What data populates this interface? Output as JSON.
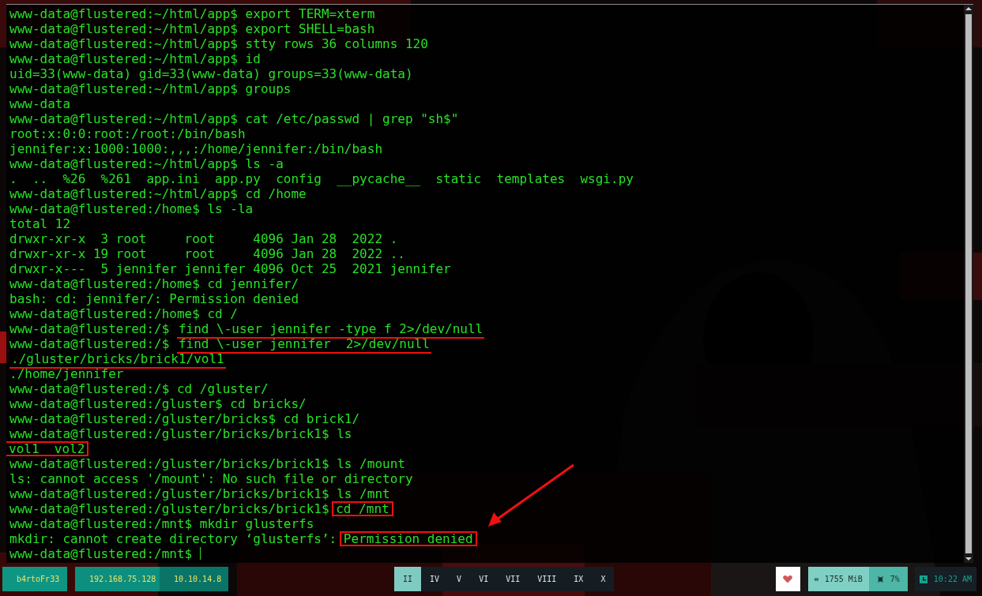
{
  "terminal": {
    "lines": [
      {
        "segments": [
          {
            "text": "www-data@flustered:~/html/app$ export TERM=xterm"
          }
        ]
      },
      {
        "segments": [
          {
            "text": "www-data@flustered:~/html/app$ export SHELL=bash"
          }
        ]
      },
      {
        "segments": [
          {
            "text": "www-data@flustered:~/html/app$ stty rows 36 columns 120"
          }
        ]
      },
      {
        "segments": [
          {
            "text": "www-data@flustered:~/html/app$ id"
          }
        ]
      },
      {
        "segments": [
          {
            "text": "uid=33(www-data) gid=33(www-data) groups=33(www-data)"
          }
        ]
      },
      {
        "segments": [
          {
            "text": "www-data@flustered:~/html/app$ groups"
          }
        ]
      },
      {
        "segments": [
          {
            "text": "www-data"
          }
        ]
      },
      {
        "segments": [
          {
            "text": "www-data@flustered:~/html/app$ cat /etc/passwd | grep \"sh$\""
          }
        ]
      },
      {
        "segments": [
          {
            "text": "root:x:0:0:root:/root:/bin/bash"
          }
        ]
      },
      {
        "segments": [
          {
            "text": "jennifer:x:1000:1000:,,,:/home/jennifer:/bin/bash"
          }
        ]
      },
      {
        "segments": [
          {
            "text": "www-data@flustered:~/html/app$ ls -a"
          }
        ]
      },
      {
        "segments": [
          {
            "text": ".  ..  %26  %261  app.ini  app.py  config  __pycache__  static  templates  wsgi.py"
          }
        ]
      },
      {
        "segments": [
          {
            "text": "www-data@flustered:~/html/app$ cd /home"
          }
        ]
      },
      {
        "segments": [
          {
            "text": "www-data@flustered:/home$ ls -la"
          }
        ]
      },
      {
        "segments": [
          {
            "text": "total 12"
          }
        ]
      },
      {
        "segments": [
          {
            "text": "drwxr-xr-x  3 root     root     4096 Jan 28  2022 ."
          }
        ]
      },
      {
        "segments": [
          {
            "text": "drwxr-xr-x 19 root     root     4096 Jan 28  2022 .."
          }
        ]
      },
      {
        "segments": [
          {
            "text": "drwxr-x---  5 jennifer jennifer 4096 Oct 25  2021 jennifer"
          }
        ]
      },
      {
        "segments": [
          {
            "text": "www-data@flustered:/home$ cd jennifer/"
          }
        ]
      },
      {
        "segments": [
          {
            "text": "bash: cd: jennifer/: Permission denied"
          }
        ]
      },
      {
        "segments": [
          {
            "text": "www-data@flustered:/home$ cd /"
          }
        ]
      },
      {
        "segments": [
          {
            "text": "www-data@flustered:/$ "
          },
          {
            "text": "find \\-user jennifer -type f 2>/dev/null",
            "underlined": true
          }
        ]
      },
      {
        "segments": [
          {
            "text": "www-data@flustered:/$ "
          },
          {
            "text": "find \\-user jennifer  2>/dev/null",
            "underlined": true
          }
        ]
      },
      {
        "segments": [
          {
            "text": "./gluster/bricks/brick1/vol1",
            "underlined": true
          }
        ]
      },
      {
        "segments": [
          {
            "text": "./home/jennifer"
          }
        ]
      },
      {
        "segments": [
          {
            "text": "www-data@flustered:/$ cd /gluster/"
          }
        ]
      },
      {
        "segments": [
          {
            "text": "www-data@flustered:/gluster$ cd bricks/"
          }
        ]
      },
      {
        "segments": [
          {
            "text": "www-data@flustered:/gluster/bricks$ cd brick1/"
          }
        ]
      },
      {
        "segments": [
          {
            "text": "www-data@flustered:/gluster/bricks/brick1$ ls"
          }
        ]
      },
      {
        "segments": [
          {
            "text": "vol1  vol2",
            "boxed": true
          }
        ]
      },
      {
        "segments": [
          {
            "text": "www-data@flustered:/gluster/bricks/brick1$ ls /mount"
          }
        ]
      },
      {
        "segments": [
          {
            "text": "ls: cannot access '/mount': No such file or directory"
          }
        ]
      },
      {
        "segments": [
          {
            "text": "www-data@flustered:/gluster/bricks/brick1$ ls /mnt"
          }
        ]
      },
      {
        "segments": [
          {
            "text": "www-data@flustered:/gluster/bricks/brick1$ "
          },
          {
            "text": "cd /mnt",
            "boxed": true
          }
        ]
      },
      {
        "segments": [
          {
            "text": "www-data@flustered:/mnt$ mkdir glusterfs"
          }
        ]
      },
      {
        "segments": [
          {
            "text": "mkdir: cannot create directory ‘glusterfs’: "
          },
          {
            "text": "Permission denied",
            "boxed": true
          }
        ]
      },
      {
        "segments": [
          {
            "text": "www-data@flustered:/mnt$ "
          }
        ],
        "cursor": true
      }
    ]
  },
  "taskbar": {
    "user": "b4rtoFr33",
    "addresses": [
      {
        "text": "192.168.75.128",
        "kind": "ethernet"
      },
      {
        "text": "10.10.14.8",
        "kind": "vpn"
      }
    ],
    "workspaces": [
      {
        "label": "II",
        "selected": true
      },
      {
        "label": "IV",
        "selected": false
      },
      {
        "label": "V",
        "selected": false
      },
      {
        "label": "VI",
        "selected": false
      },
      {
        "label": "VII",
        "selected": false
      },
      {
        "label": "VIII",
        "selected": false
      },
      {
        "label": "IX",
        "selected": false
      },
      {
        "label": "X",
        "selected": false
      }
    ],
    "memory": "1755 MiB",
    "cpu": "7%",
    "clock": "10:22 AM"
  }
}
